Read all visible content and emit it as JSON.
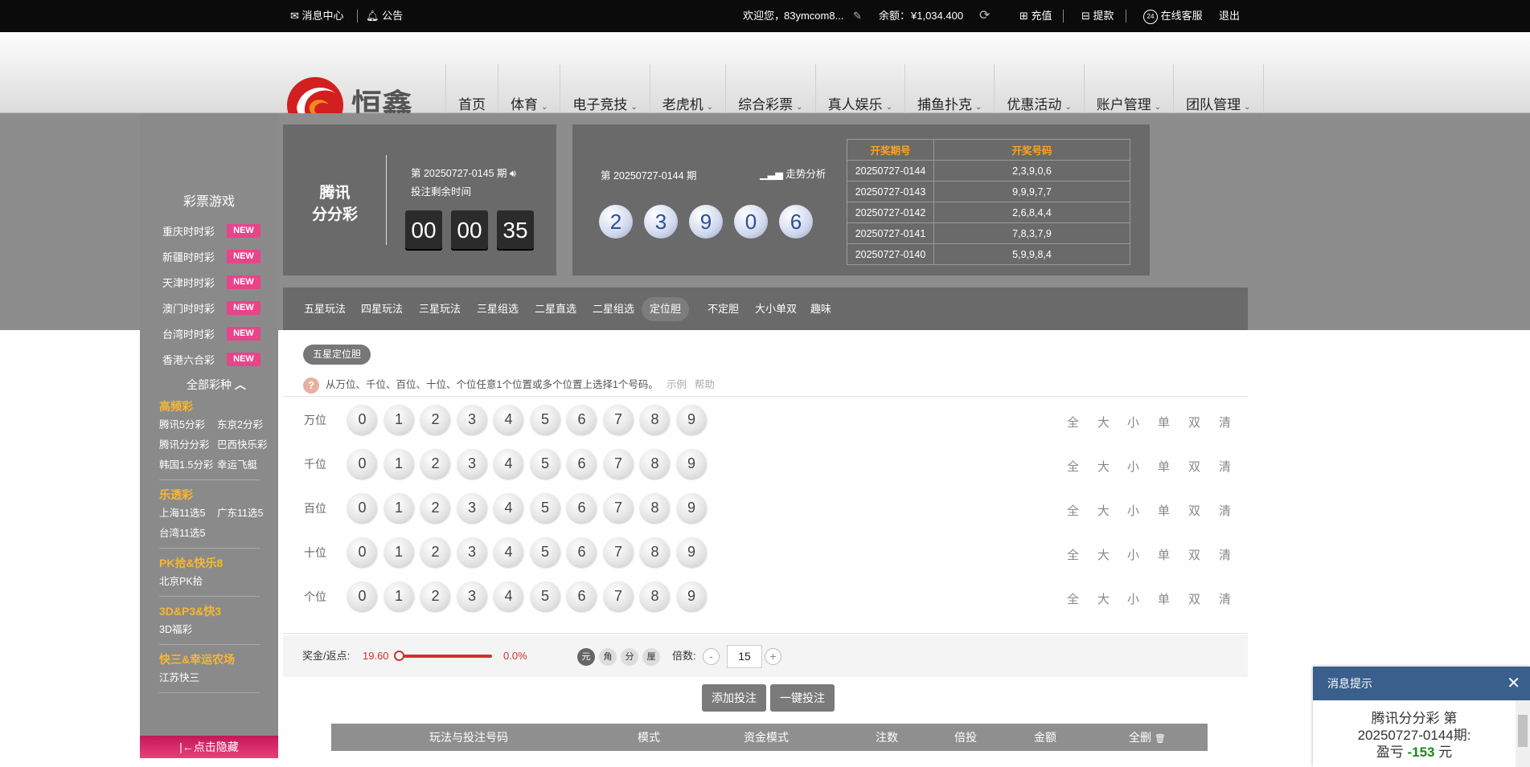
{
  "topbar": {
    "messages": "消息中心",
    "notice": "公告",
    "welcome": "欢迎您，",
    "username": "83ymcom8...",
    "balance_label": "余额：",
    "balance_value": "¥1,034.400",
    "deposit": "充值",
    "withdraw": "提款",
    "service_badge": "24",
    "service": "在线客服",
    "logout": "退出"
  },
  "brand": {
    "name": "恒鑫",
    "color": "#d31f1f"
  },
  "nav": [
    {
      "label": "首页",
      "dropdown": false
    },
    {
      "label": "体育",
      "dropdown": true
    },
    {
      "label": "电子竞技",
      "dropdown": true
    },
    {
      "label": "老虎机",
      "dropdown": true
    },
    {
      "label": "综合彩票",
      "dropdown": true
    },
    {
      "label": "真人娱乐",
      "dropdown": true
    },
    {
      "label": "捕鱼扑克",
      "dropdown": true
    },
    {
      "label": "优惠活动",
      "dropdown": true
    },
    {
      "label": "账户管理",
      "dropdown": true
    },
    {
      "label": "团队管理",
      "dropdown": true
    }
  ],
  "sidebar": {
    "title": "彩票游戏",
    "new_badge": "NEW",
    "featured": [
      "重庆时时彩",
      "新疆时时彩",
      "天津时时彩",
      "澳门时时彩",
      "台湾时时彩",
      "香港六合彩"
    ],
    "all_label": "全部彩种",
    "categories": [
      {
        "name": "高频彩",
        "items": [
          "腾讯5分彩",
          "东京2分彩",
          "腾讯分分彩",
          "巴西快乐彩",
          "韩国1.5分彩",
          "幸运飞艇"
        ]
      },
      {
        "name": "乐透彩",
        "items": [
          "上海11选5",
          "广东11选5",
          "台湾11选5"
        ]
      },
      {
        "name": "PK拾&快乐8",
        "items": [
          "北京PK拾"
        ]
      },
      {
        "name": "3D&P3&快3",
        "items": [
          "3D福彩"
        ]
      },
      {
        "name": "快三&幸运农场",
        "items": [
          "江苏快三"
        ]
      }
    ],
    "hide_label": "点击隐藏"
  },
  "lottery": {
    "name_line1": "腾讯",
    "name_line2": "分分彩",
    "current_issue": "第 20250727-0145 期",
    "countdown_label": "投注剩余时间",
    "countdown": [
      "00",
      "00",
      "35"
    ],
    "last_issue": "第 20250727-0144 期",
    "trend_label": "走势分析",
    "last_numbers": [
      "2",
      "3",
      "9",
      "0",
      "6"
    ],
    "history_headers": [
      "开奖期号",
      "开奖号码"
    ],
    "history": [
      {
        "issue": "20250727-0144",
        "numbers": "2,3,9,0,6"
      },
      {
        "issue": "20250727-0143",
        "numbers": "9,9,9,7,7"
      },
      {
        "issue": "20250727-0142",
        "numbers": "2,6,8,4,4"
      },
      {
        "issue": "20250727-0141",
        "numbers": "7,8,3,7,9"
      },
      {
        "issue": "20250727-0140",
        "numbers": "5,9,9,8,4"
      }
    ]
  },
  "play_tabs": [
    "五星玩法",
    "四星玩法",
    "三星玩法",
    "三星组选",
    "二星直选",
    "二星组选",
    "定位胆",
    "不定胆",
    "大小单双",
    "趣味"
  ],
  "active_tab": "定位胆",
  "sub_tab": "五星定位胆",
  "hint": {
    "text": "从万位、千位、百位、十位、个位任意1个位置或多个位置上选择1个号码。",
    "example": "示例",
    "help": "帮助"
  },
  "positions": [
    "万位",
    "千位",
    "百位",
    "十位",
    "个位"
  ],
  "digits": [
    "0",
    "1",
    "2",
    "3",
    "4",
    "5",
    "6",
    "7",
    "8",
    "9"
  ],
  "quick_select": [
    "全",
    "大",
    "小",
    "单",
    "双",
    "清"
  ],
  "bet": {
    "prize_label": "奖金/返点:",
    "prize_value": "19.60",
    "rebate_value": "0.0%",
    "rebate_fraction": 0.0,
    "units": [
      "元",
      "角",
      "分",
      "厘"
    ],
    "active_unit": "元",
    "multiple_label": "倍数:",
    "minus": "-",
    "plus": "+",
    "multiple": "15",
    "add_button": "添加投注",
    "quick_button": "一键投注"
  },
  "bet_table_headers": [
    "玩法与投注号码",
    "模式",
    "资金模式",
    "注数",
    "倍投",
    "金额",
    "全删"
  ],
  "toast": {
    "title": "消息提示",
    "line1": "腾讯分分彩 第",
    "line2": "20250727-0144期:",
    "profit_label": "盈亏",
    "profit_value": "-153",
    "currency": "元"
  }
}
